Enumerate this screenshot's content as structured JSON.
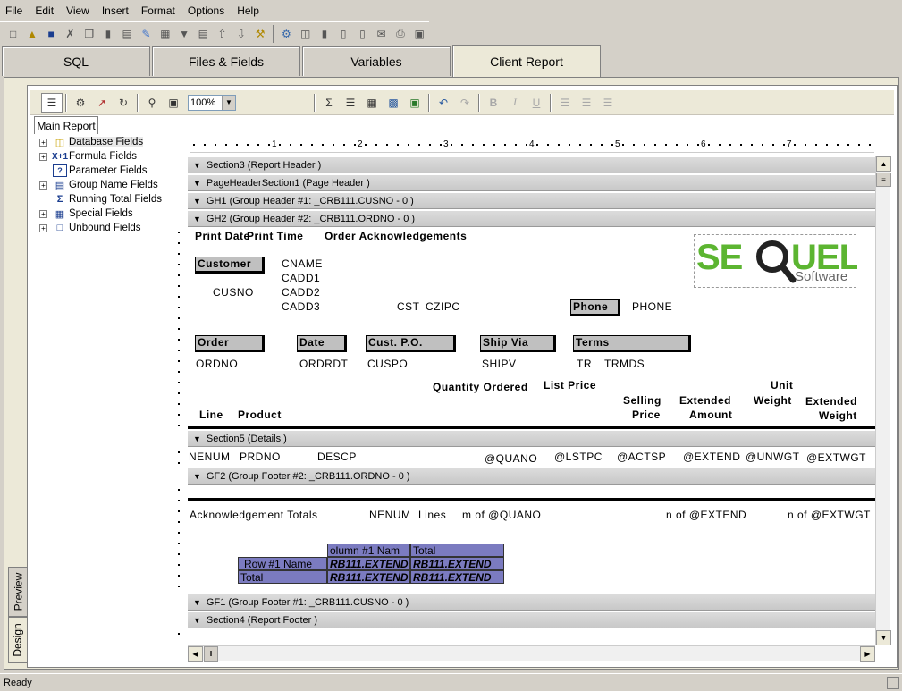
{
  "menu": [
    "File",
    "Edit",
    "View",
    "Insert",
    "Format",
    "Options",
    "Help"
  ],
  "tabs": [
    {
      "label": "SQL",
      "active": false
    },
    {
      "label": "Files & Fields",
      "active": false
    },
    {
      "label": "Variables",
      "active": false
    },
    {
      "label": "Client Report",
      "active": true
    }
  ],
  "report_toolbar": {
    "zoom": "100%"
  },
  "report_tab": "Main Report",
  "tree": [
    {
      "label": "Database Fields",
      "icon": "database-icon",
      "expandable": true,
      "selected": true
    },
    {
      "label": "Formula Fields",
      "icon": "formula-icon",
      "expandable": true
    },
    {
      "label": "Parameter Fields",
      "icon": "parameter-icon",
      "expandable": false
    },
    {
      "label": "Group Name Fields",
      "icon": "group-name-icon",
      "expandable": true
    },
    {
      "label": "Running Total Fields",
      "icon": "running-total-icon",
      "expandable": false
    },
    {
      "label": "Special Fields",
      "icon": "special-fields-icon",
      "expandable": true
    },
    {
      "label": "Unbound Fields",
      "icon": "unbound-fields-icon",
      "expandable": true
    }
  ],
  "ruler": [
    "1",
    "2",
    "3",
    "4",
    "5",
    "6",
    "7"
  ],
  "sections": {
    "report_header": "Section3 (Report Header )",
    "page_header": "PageHeaderSection1 (Page Header )",
    "gh1": "GH1 (Group Header #1: _CRB111.CUSNO - 0 )",
    "gh2": "GH2 (Group Header #2: _CRB111.ORDNO - 0 )",
    "details": "Section5 (Details )",
    "gf2": "GF2 (Group Footer #2: _CRB111.ORDNO - 0 )",
    "gf1": "GF1 (Group Footer #1: _CRB111.CUSNO - 0 )",
    "report_footer": "Section4 (Report Footer )"
  },
  "gh2": {
    "print_date": "Print Date",
    "print_time": "Print Time",
    "title": "Order Acknowledgements",
    "customer_label": "Customer",
    "cusno": "CUSNO",
    "cname": "CNAME",
    "cadd1": "CADD1",
    "cadd2": "CADD2",
    "cadd3": "CADD3",
    "cst": "CST",
    "czipc": "CZIPC",
    "phone_label": "Phone",
    "phone": "PHONE",
    "order_label": "Order",
    "date_label": "Date",
    "custpo_label": "Cust. P.O.",
    "shipvia_label": "Ship Via",
    "terms_label": "Terms",
    "ordno": "ORDNO",
    "ordrdt": "ORDRDT",
    "cuspo": "CUSPO",
    "shipv": "SHIPV",
    "tr": "TR",
    "trmds": "TRMDS",
    "col_line": "Line",
    "col_product": "Product",
    "col_qty": "Quantity Ordered",
    "col_list": "List Price",
    "col_selling_1": "Selling",
    "col_selling_2": "Price",
    "col_ext_1": "Extended",
    "col_ext_2": "Amount",
    "col_unit_1": "Unit",
    "col_unit_2": "Weight",
    "col_extw_1": "Extended",
    "col_extw_2": "Weight"
  },
  "logo": {
    "main": "SEQUEL",
    "sub": "Software"
  },
  "details": {
    "nenum": "NENUM",
    "prdno": "PRDNO",
    "descp": "DESCP",
    "quano": "@QUANO",
    "lstpc": "@LSTPC",
    "actsp": "@ACTSP",
    "extend": "@EXTEND",
    "unwgt": "@UNWGT",
    "extwgt": "@EXTWGT"
  },
  "gf2": {
    "ack_totals": "Acknowledgement Totals",
    "nenum": "NENUM",
    "lines": "Lines",
    "sum_quano": "m of @QUANO",
    "sum_extend": "n of @EXTEND",
    "sum_extwgt": "n of @EXTWGT",
    "xtab_col": "olumn #1 Nam",
    "xtab_total_hdr": "Total",
    "xtab_row": "Row #1 Name",
    "xtab_cell": "RB111.EXTEND",
    "xtab_total_row": "Total"
  },
  "side_tabs": [
    "Preview",
    "Design"
  ],
  "status": "Ready",
  "colors": {
    "crosstab": "#7b7bc0",
    "logo_green": "#5cb531",
    "logo_gray": "#666666"
  }
}
